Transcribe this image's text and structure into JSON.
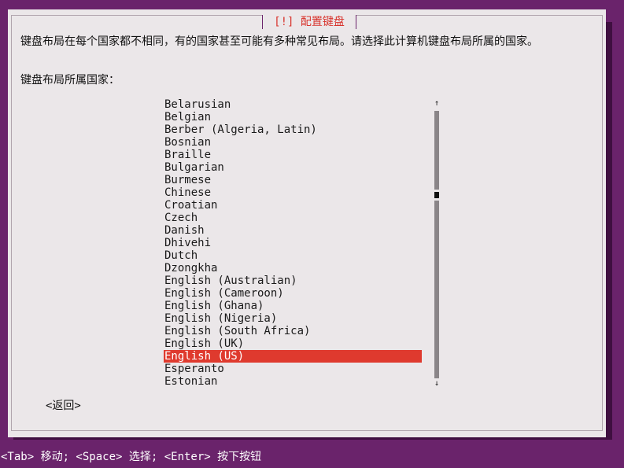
{
  "dialog": {
    "title": "[!] 配置键盘",
    "prompt": "键盘布局在每个国家都不相同，有的国家甚至可能有多种常见布局。请选择此计算机键盘布局所属的国家。",
    "list_label": "键盘布局所属国家："
  },
  "countries": [
    "Belarusian",
    "Belgian",
    "Berber (Algeria, Latin)",
    "Bosnian",
    "Braille",
    "Bulgarian",
    "Burmese",
    "Chinese",
    "Croatian",
    "Czech",
    "Danish",
    "Dhivehi",
    "Dutch",
    "Dzongkha",
    "English (Australian)",
    "English (Cameroon)",
    "English (Ghana)",
    "English (Nigeria)",
    "English (South Africa)",
    "English (UK)",
    "English (US)",
    "Esperanto",
    "Estonian"
  ],
  "selected_country": "English (US)",
  "scrollbar": {
    "up_arrow": "↑",
    "down_arrow": "↓",
    "position_fraction": 0.32
  },
  "buttons": {
    "back": "<返回>"
  },
  "status_bar": {
    "hint": "<Tab> 移动; <Space> 选择; <Enter> 按下按钮"
  },
  "colors": {
    "background": "#6a236b",
    "dialog": "#ebe7e9",
    "accent": "#df3a2e",
    "title": "#d8342d"
  }
}
